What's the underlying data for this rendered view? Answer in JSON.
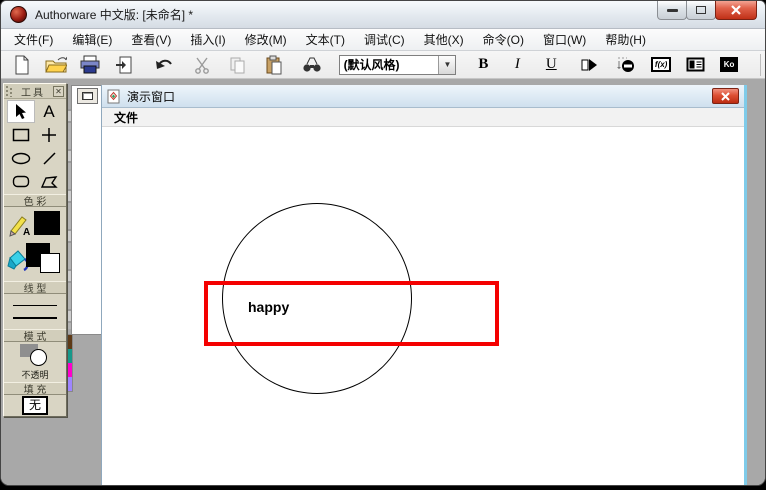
{
  "app_window": {
    "title": "Authorware 中文版: [未命名] *"
  },
  "menubar": {
    "items": [
      "文件(F)",
      "编辑(E)",
      "查看(V)",
      "插入(I)",
      "修改(M)",
      "文本(T)",
      "调试(C)",
      "其他(X)",
      "命令(O)",
      "窗口(W)",
      "帮助(H)"
    ]
  },
  "toolbar": {
    "style_value": "(默认风格)",
    "dropdown_arrow": "▼",
    "bold_label": "B",
    "italic_label": "I",
    "underline_label": "U",
    "functions_label": "f(x)",
    "knowledge_label": "Ko",
    "icons": [
      "new-icon",
      "open-icon",
      "publish-icon",
      "import-icon",
      "undo-icon",
      "cut-icon",
      "copy-icon",
      "paste-icon",
      "find-icon",
      "run-icon",
      "control-panel-icon",
      "functions-icon",
      "variables-icon",
      "knowledge-objects-icon"
    ]
  },
  "tool_palette": {
    "title": "工具",
    "close_glyph": "✕",
    "text_tool_label": "A",
    "pen_letter": "A",
    "section_colors": "色 彩",
    "section_lines": "线 型",
    "section_modes": "模 式",
    "section_fill": "填 充",
    "mode_label": "不透明",
    "fill_value": "无"
  },
  "palette_strip_colors": {
    "c0": "#5e3a17",
    "c1": "#16988a",
    "c2": "#ff00cc",
    "c3": "#9e85ff"
  },
  "presentation_window": {
    "title": "演示窗口",
    "menu_file": "文件",
    "canvas": {
      "text": "happy",
      "rect_border_color": "#f40000",
      "circle_border_color": "#000000"
    }
  }
}
